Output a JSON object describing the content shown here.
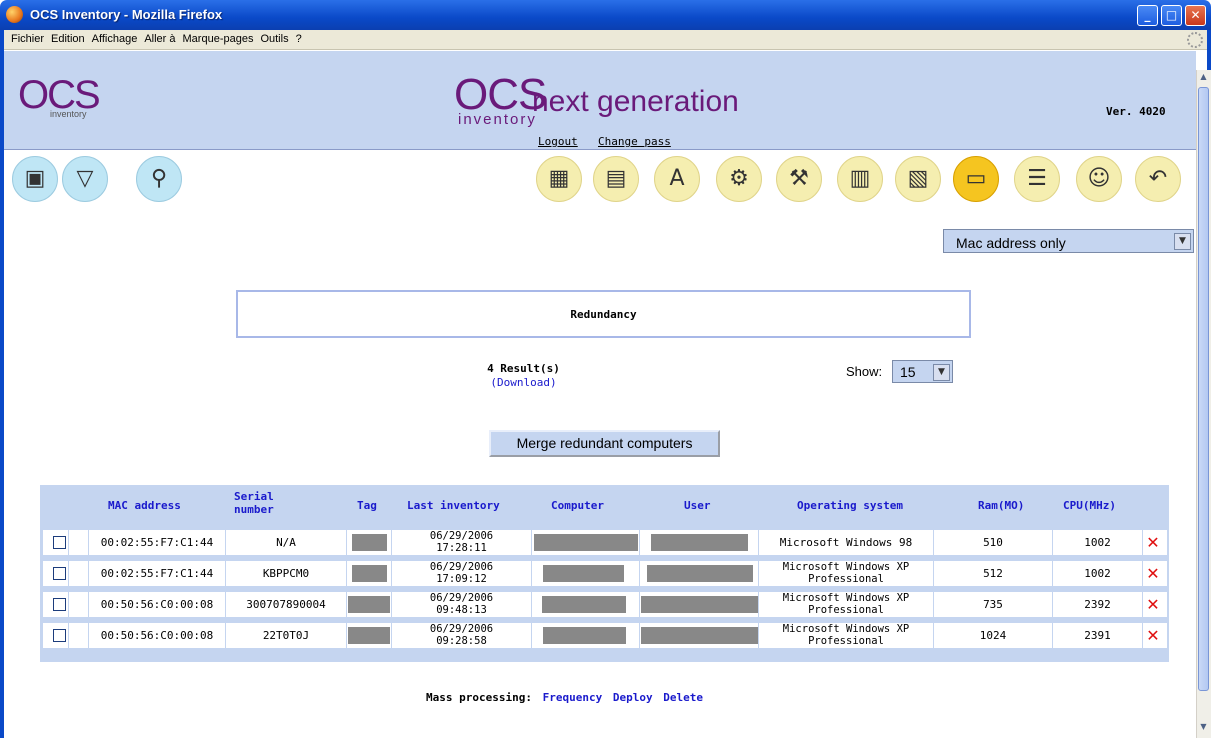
{
  "window": {
    "title": "OCS Inventory - Mozilla Firefox"
  },
  "menu": [
    "Fichier",
    "Edition",
    "Affichage",
    "Aller à",
    "Marque-pages",
    "Outils",
    "?"
  ],
  "header": {
    "logo_small": "OCS",
    "logo_small_sub": "inventory",
    "logo_big": "OCS",
    "logo_big_tail": "next generation",
    "logo_big_sub": "inventory",
    "version": "Ver. 4020",
    "logout": "Logout",
    "change_pass": "Change pass"
  },
  "left_icons": [
    "computers-icon",
    "filter-icon",
    "search-icon"
  ],
  "right_icons": [
    "packages-icon",
    "firewall-icon",
    "dictionary-icon",
    "config-icon",
    "tools-icon",
    "registry-icon",
    "labels-icon",
    "redundancy-icon",
    "rules-icon",
    "admin-icon",
    "back-icon"
  ],
  "mac_select": {
    "value": "Mac address only"
  },
  "redundancy": {
    "title": "Redundancy"
  },
  "results": {
    "count": "4 Result(s)",
    "download": "(Download)"
  },
  "show": {
    "label": "Show:",
    "value": "15"
  },
  "merge_button": "Merge redundant computers",
  "table": {
    "columns": [
      "MAC address",
      "Serial number",
      "Tag",
      "Last inventory",
      "Computer",
      "User",
      "Operating system",
      "Ram(MO)",
      "CPU(MHz)"
    ],
    "rows": [
      {
        "mac": "00:02:55:F7:C1:44",
        "serial": "N/A",
        "date": "06/29/2006",
        "time": "17:28:11",
        "os1": "Microsoft Windows 98",
        "os2": "",
        "ram": "510",
        "cpu": "1002"
      },
      {
        "mac": "00:02:55:F7:C1:44",
        "serial": "KBPPCM0",
        "date": "06/29/2006",
        "time": "17:09:12",
        "os1": "Microsoft Windows XP",
        "os2": "Professional",
        "ram": "512",
        "cpu": "1002"
      },
      {
        "mac": "00:50:56:C0:00:08",
        "serial": "300707890004",
        "date": "06/29/2006",
        "time": "09:48:13",
        "os1": "Microsoft Windows XP",
        "os2": "Professional",
        "ram": "735",
        "cpu": "2392"
      },
      {
        "mac": "00:50:56:C0:00:08",
        "serial": "22T0T0J",
        "date": "06/29/2006",
        "time": "09:28:58",
        "os1": "Microsoft Windows XP",
        "os2": "Professional",
        "ram": "1024",
        "cpu": "2391"
      }
    ]
  },
  "mass": {
    "label": "Mass processing:",
    "frequency": "Frequency",
    "deploy": "Deploy",
    "delete": "Delete"
  },
  "colors": {
    "header_bg": "#c5d5f0",
    "link": "#1a1acc",
    "accent": "#6a1a7a",
    "delete": "#e01010"
  }
}
